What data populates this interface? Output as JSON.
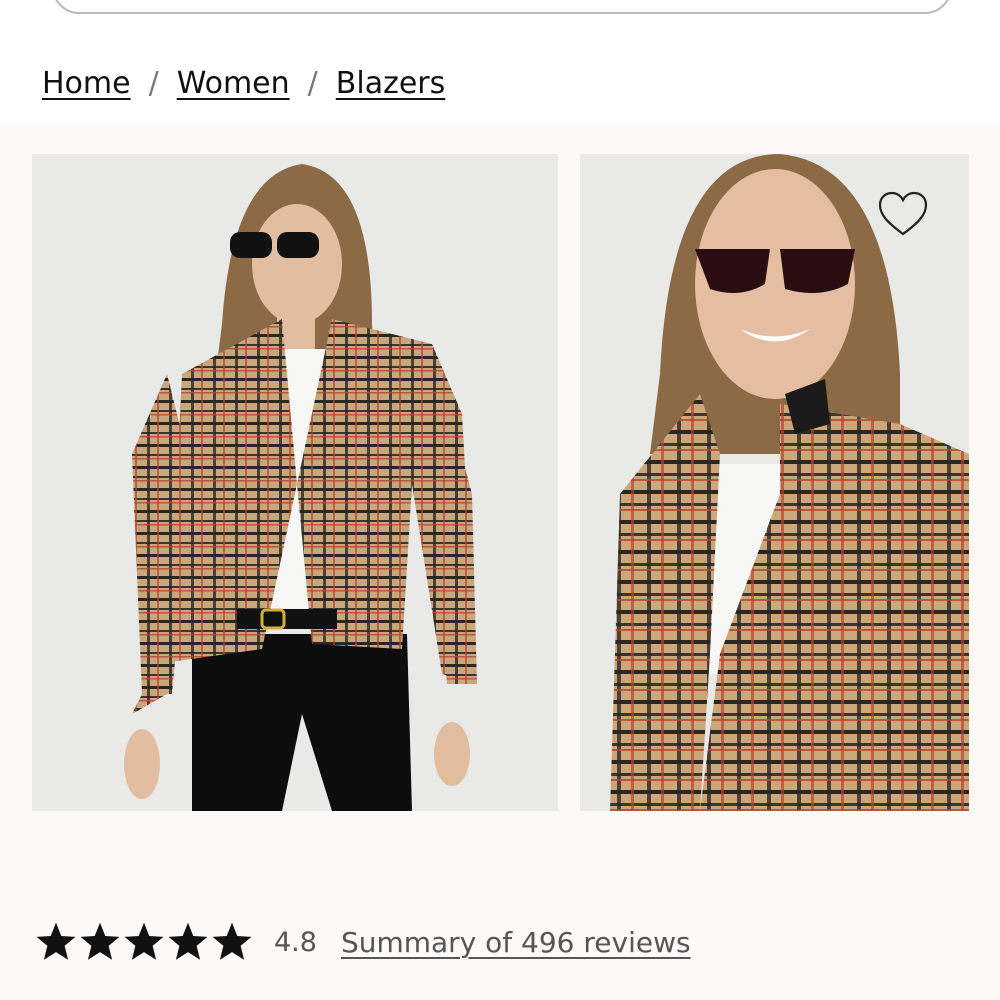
{
  "search": {
    "placeholder": ""
  },
  "breadcrumb": {
    "items": [
      "Home",
      "Women",
      "Blazers"
    ],
    "separator": "/"
  },
  "gallery": {
    "images": [
      {
        "alt": "woman-in-plaid-blazer-full-view"
      },
      {
        "alt": "woman-in-plaid-blazer-closeup"
      }
    ],
    "favorite_icon": "heart-outline-icon"
  },
  "rating": {
    "value": "4.8",
    "stars": 5,
    "reviews_link": "Summary of 496 reviews"
  },
  "colors": {
    "background": "#fcf9f6",
    "photo_bg": "#e9e9e8",
    "text": "#111111",
    "muted": "#555555"
  }
}
